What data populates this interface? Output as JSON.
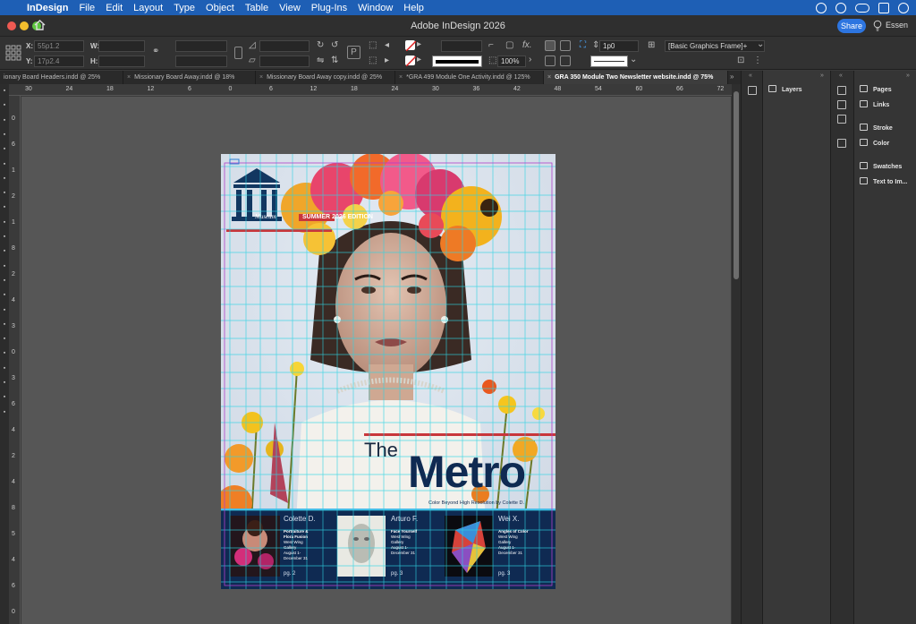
{
  "menubar": {
    "apple": "",
    "app": "InDesign",
    "items": [
      "File",
      "Edit",
      "Layout",
      "Type",
      "Object",
      "Table",
      "View",
      "Plug-Ins",
      "Window",
      "Help"
    ]
  },
  "window": {
    "title": "Adobe InDesign 2026",
    "share_label": "Share",
    "user_label": "Essen"
  },
  "control": {
    "x_label": "X:",
    "x_value": "55p1.2",
    "y_label": "Y:",
    "y_value": "17p2.4",
    "w_label": "W:",
    "h_label": "H:",
    "zoom_value": "100%",
    "stroke_weight": "1p0",
    "object_style": "[Basic Graphics Frame]+"
  },
  "tabs": [
    {
      "label": "ionary Board Headers.indd @ 25%",
      "active": false
    },
    {
      "label": "Missionary Board Away.indd @ 18%",
      "active": false
    },
    {
      "label": "Missionary Board Away copy.indd @ 25%",
      "active": false
    },
    {
      "label": "*GRA 499 Module One Activity.indd @ 125%",
      "active": false
    },
    {
      "label": "GRA 350 Module Two Newsletter website.indd @ 75%",
      "active": true
    }
  ],
  "ruler": {
    "h_ticks": [
      "30",
      "24",
      "18",
      "12",
      "6",
      "0",
      "6",
      "12",
      "18",
      "24",
      "30",
      "36",
      "42",
      "48",
      "54",
      "60",
      "66",
      "72"
    ],
    "v_ticks": [
      "0",
      "6",
      "1",
      "2",
      "1",
      "8",
      "2",
      "4",
      "3",
      "0",
      "3",
      "6",
      "4",
      "2",
      "4",
      "8",
      "5",
      "4",
      "6",
      "0"
    ]
  },
  "panels": {
    "layers_label": "Layers",
    "items": [
      "Pages",
      "Links",
      "Stroke",
      "Color",
      "Swatches",
      "Text to Im..."
    ]
  },
  "document": {
    "edition": "SUMMER 2026 EDITION",
    "logo_script": "Museum",
    "headline_small": "The",
    "headline_big": "Metro",
    "tagline": "Color Beyond High Resolution by Colette D.",
    "cards": [
      {
        "artist": "Colette D.",
        "lines": [
          "Portraiture &",
          "Flora Fusion",
          "West Wing",
          "Gallery",
          "August 1-",
          "December 31"
        ],
        "page": "pg. 2"
      },
      {
        "artist": "Arturo F.",
        "lines": [
          "Face Yourself",
          "West Wing",
          "Gallery",
          "August 1-",
          "December 31"
        ],
        "page": "pg. 3"
      },
      {
        "artist": "Wei X.",
        "lines": [
          "Angles of Color",
          "West Wing",
          "Gallery",
          "August 1-",
          "December 31"
        ],
        "page": "pg. 3"
      }
    ]
  },
  "colors": {
    "menubar": "#1e5fb5",
    "navy": "#0f2a52",
    "guide": "#2fd3e3",
    "margin": "#b13fc9",
    "accent_red": "#c9363b"
  }
}
